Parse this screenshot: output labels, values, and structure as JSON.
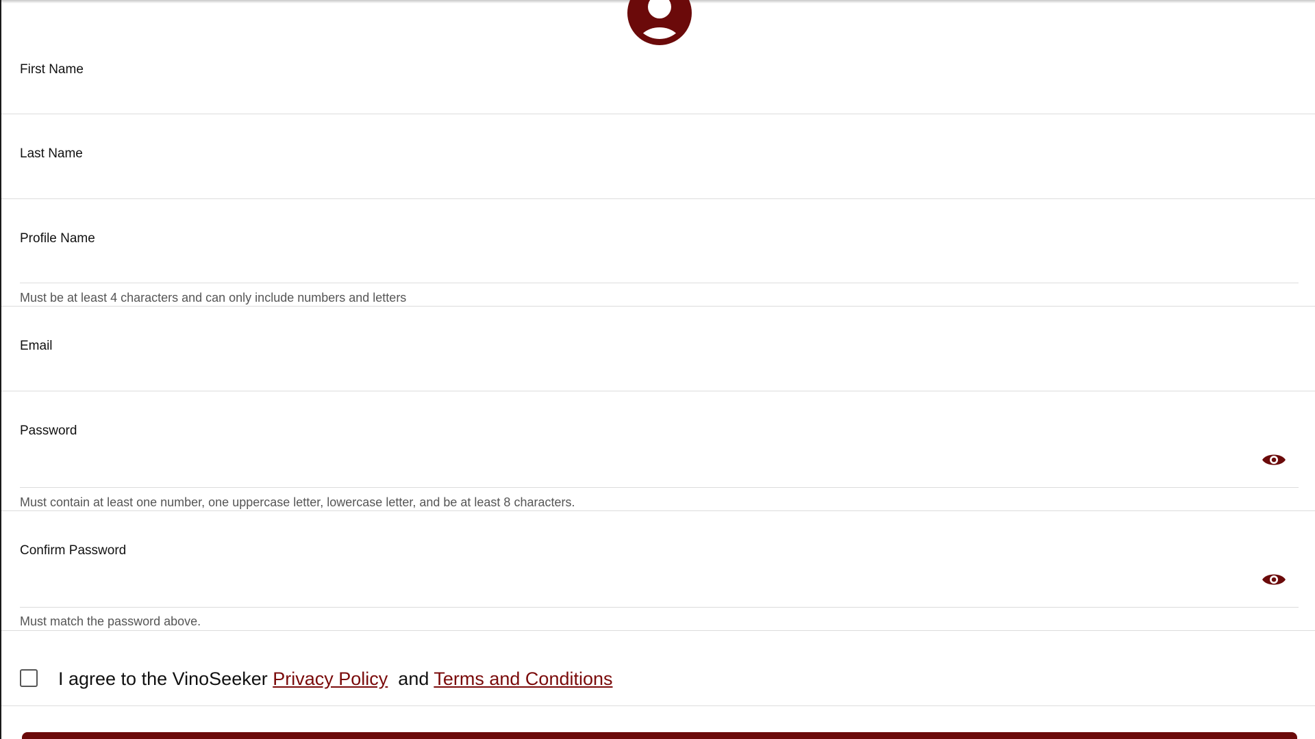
{
  "brand": {
    "accent_color": "#6b0a0a",
    "avatar_icon": "user-circle-icon",
    "eye_icon": "eye-icon"
  },
  "form": {
    "first_name": {
      "label": "First Name",
      "value": ""
    },
    "last_name": {
      "label": "Last Name",
      "value": ""
    },
    "profile_name": {
      "label": "Profile Name",
      "value": "",
      "helper": "Must be at least 4 characters and can only include numbers and letters"
    },
    "email": {
      "label": "Email",
      "value": ""
    },
    "password": {
      "label": "Password",
      "value": "",
      "helper": "Must contain at least one number, one uppercase letter, lowercase letter, and be at least 8 characters."
    },
    "confirm_password": {
      "label": "Confirm Password",
      "value": "",
      "helper": "Must match the password above."
    },
    "agreement": {
      "checked": false,
      "prefix": "I agree to the VinoSeeker",
      "privacy_link": "Privacy Policy",
      "and_text": "and",
      "terms_link": "Terms and Conditions"
    }
  }
}
